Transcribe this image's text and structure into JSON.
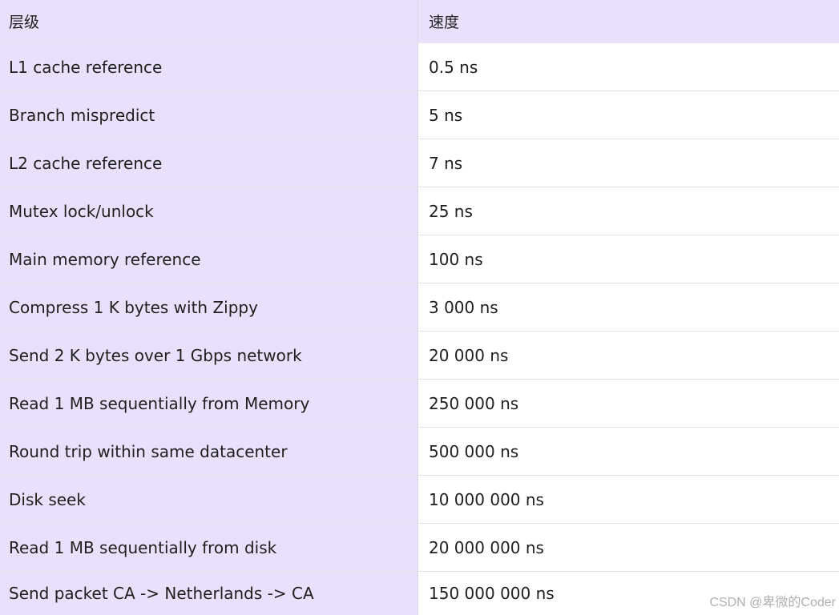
{
  "header": {
    "col_level": "层级",
    "col_speed": "速度"
  },
  "rows": [
    {
      "level": "L1 cache reference",
      "speed": "0.5 ns"
    },
    {
      "level": "Branch mispredict",
      "speed": "5 ns"
    },
    {
      "level": "L2 cache reference",
      "speed": "7 ns"
    },
    {
      "level": "Mutex lock/unlock",
      "speed": "25 ns"
    },
    {
      "level": "Main memory reference",
      "speed": "100 ns"
    },
    {
      "level": "Compress 1 K bytes with Zippy",
      "speed": "3 000 ns"
    },
    {
      "level": "Send 2 K bytes over 1 Gbps network",
      "speed": "20 000 ns"
    },
    {
      "level": "Read 1 MB sequentially from Memory",
      "speed": "250 000 ns"
    },
    {
      "level": "Round trip within same datacenter",
      "speed": "500 000 ns"
    },
    {
      "level": "Disk seek",
      "speed": "10 000 000 ns"
    },
    {
      "level": "Read 1 MB sequentially from disk",
      "speed": "20 000 000 ns"
    },
    {
      "level": "Send packet CA -> Netherlands -> CA",
      "speed": "150 000 000 ns"
    }
  ],
  "watermark": "CSDN @卑微的Coder",
  "colors": {
    "header_bg": "#e9e0fb",
    "left_col_bg": "#e9e0fb",
    "right_col_bg": "#ffffff"
  }
}
